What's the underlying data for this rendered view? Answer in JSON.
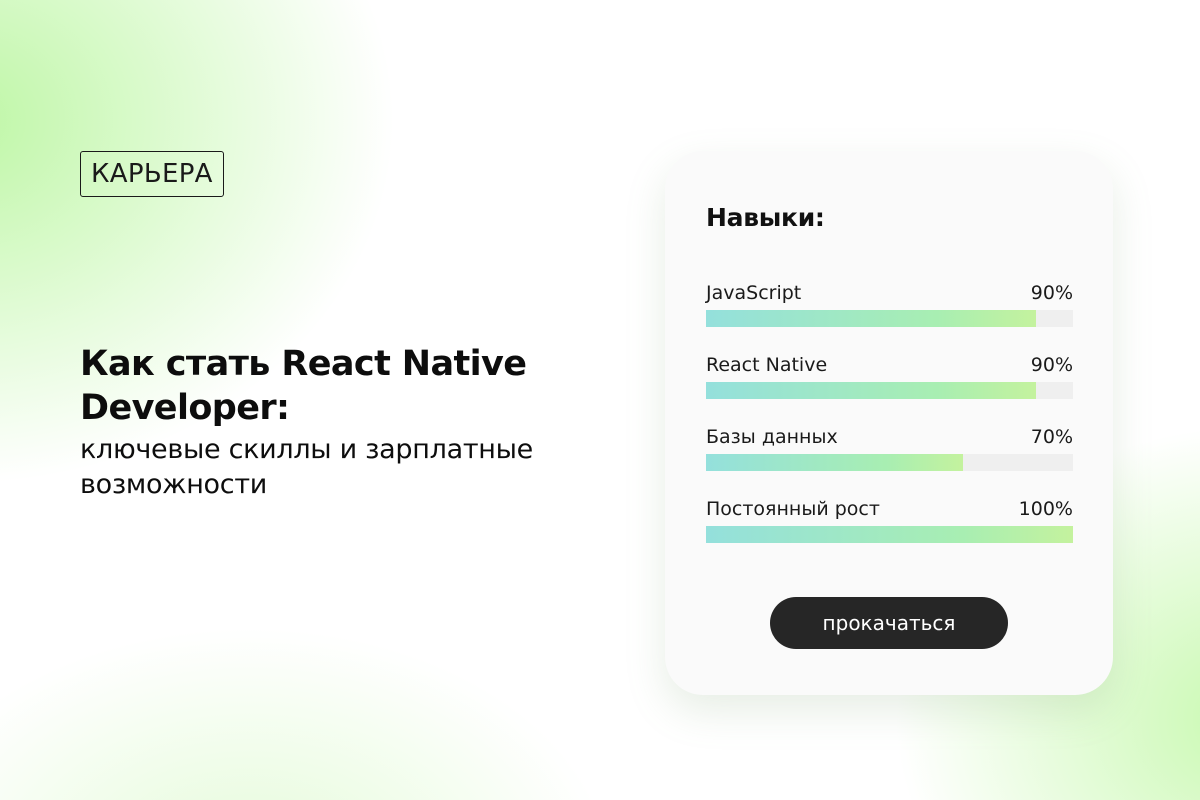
{
  "tag": "КАРЬЕРА",
  "headline": {
    "main": "Как стать React Native Developer:",
    "sub": "ключевые скиллы и зарплатные возможности"
  },
  "card": {
    "title": "Навыки:",
    "skills": [
      {
        "label": "JavaScript",
        "percent_label": "90%",
        "value": 90
      },
      {
        "label": "React Native",
        "percent_label": "90%",
        "value": 90
      },
      {
        "label": "Базы данных",
        "percent_label": "70%",
        "value": 70
      },
      {
        "label": "Постоянный рост",
        "percent_label": "100%",
        "value": 100
      }
    ],
    "button_label": "прокачаться"
  },
  "colors": {
    "bar_start": "#94e0dc",
    "bar_end": "#c4f29e",
    "button_bg": "#262626",
    "card_bg": "#fafafa"
  }
}
